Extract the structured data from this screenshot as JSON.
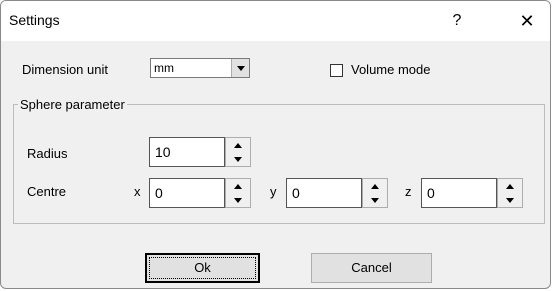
{
  "window": {
    "title": "Settings",
    "help_label": "?",
    "close_label": "✕"
  },
  "dimension": {
    "label": "Dimension unit",
    "selected": "mm"
  },
  "volume_mode": {
    "label": "Volume mode",
    "checked": false
  },
  "sphere": {
    "group_label": "Sphere parameter",
    "radius_label": "Radius",
    "radius_value": "10",
    "centre_label": "Centre",
    "x_label": "x",
    "x_value": "0",
    "y_label": "y",
    "y_value": "0",
    "z_label": "z",
    "z_value": "0"
  },
  "buttons": {
    "ok_label": "Ok",
    "cancel_label": "Cancel"
  }
}
